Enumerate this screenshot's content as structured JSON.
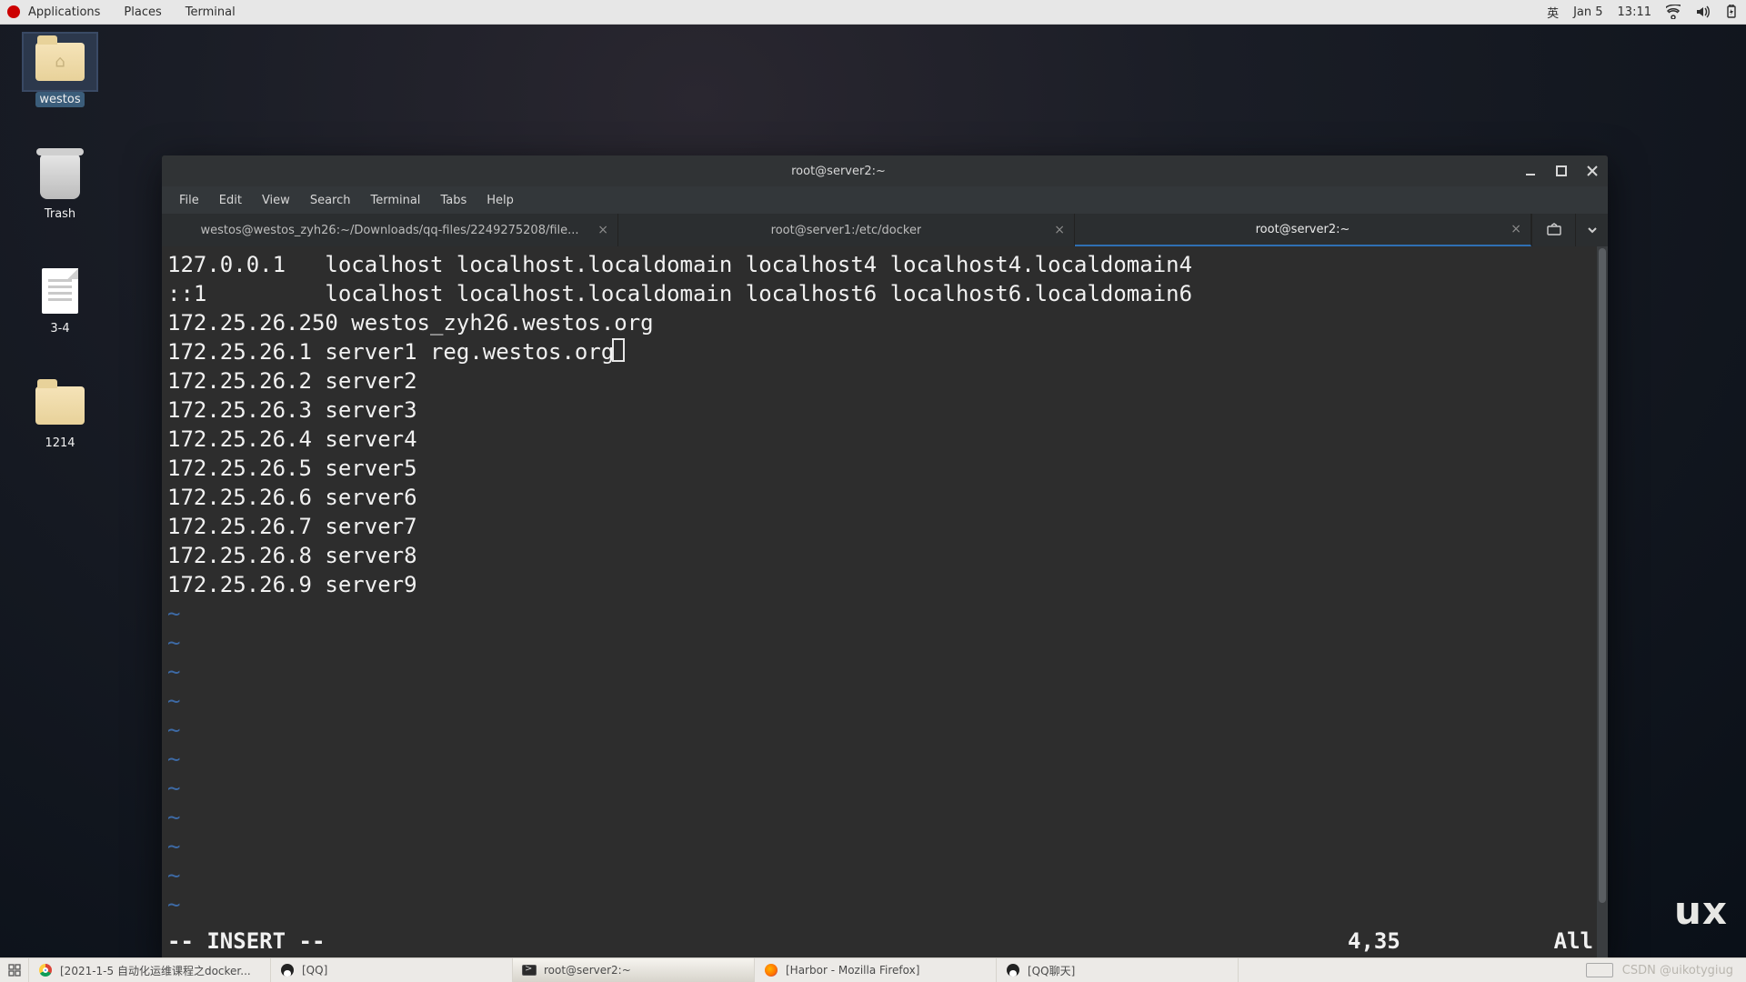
{
  "panel": {
    "apps": "Applications",
    "places": "Places",
    "terminal": "Terminal",
    "ime": "英",
    "date": "Jan 5",
    "time": "13:11"
  },
  "desktop": {
    "icon_home": "westos",
    "icon_trash": "Trash",
    "icon_doc": "3-4",
    "icon_folder": "1214"
  },
  "watermark_ux": "ux",
  "window": {
    "title": "root@server2:~",
    "menus": {
      "file": "File",
      "edit": "Edit",
      "view": "View",
      "search": "Search",
      "terminal": "Terminal",
      "tabs": "Tabs",
      "help": "Help"
    },
    "tabs": {
      "t1": "westos@westos_zyh26:~/Downloads/qq-files/2249275208/file...",
      "t2": "root@server1:/etc/docker",
      "t3": "root@server2:~"
    }
  },
  "terminal": {
    "l0": "127.0.0.1   localhost localhost.localdomain localhost4 localhost4.localdomain4",
    "l1": "::1         localhost localhost.localdomain localhost6 localhost6.localdomain6",
    "l2": "172.25.26.250 westos_zyh26.westos.org",
    "l3": "172.25.26.1 server1 reg.westos.org",
    "l4": "172.25.26.2 server2",
    "l5": "172.25.26.3 server3",
    "l6": "172.25.26.4 server4",
    "l7": "172.25.26.5 server5",
    "l8": "172.25.26.6 server6",
    "l9": "172.25.26.7 server7",
    "l10": "172.25.26.8 server8",
    "l11": "172.25.26.9 server9",
    "tilde": "~",
    "status_mode": "-- INSERT --",
    "status_pos": "4,35",
    "status_all": "All"
  },
  "taskbar": {
    "t1": "[2021-1-5 自动化运维课程之docker...",
    "t2": "[QQ]",
    "t3": "root@server2:~",
    "t4": "[Harbor - Mozilla Firefox]",
    "t5": "[QQ聊天]",
    "watermark": "CSDN @uikotygiug"
  }
}
